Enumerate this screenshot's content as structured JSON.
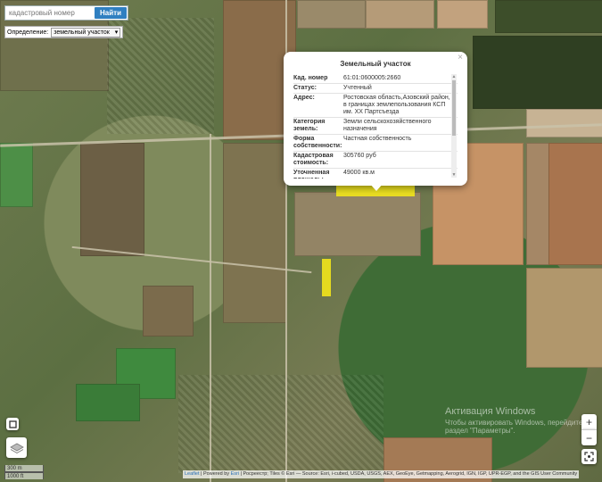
{
  "search": {
    "placeholder": "кадастровый номер",
    "button_label": "Найти"
  },
  "definition": {
    "label": "Определение:",
    "selected": "земельный участок",
    "dropdown_icon": "chevron-down-icon"
  },
  "popup": {
    "title": "Земельный участок",
    "close_symbol": "×",
    "rows": [
      {
        "key": "Кад. номер",
        "value": "61:01:0600005:2660"
      },
      {
        "key": "Статус:",
        "value": "Учтенный"
      },
      {
        "key": "Адрес:",
        "value": "Ростовская область,Азовский район, в границах землепользования КСП им. XX Партсъезда"
      },
      {
        "key": "Категория земель:",
        "value": "Земли сельскохозяйственного назначения"
      },
      {
        "key": "Форма собственности:",
        "value": "Частная собственность"
      },
      {
        "key": "Кадастровая стоимость:",
        "value": "305760 руб"
      },
      {
        "key": "Уточненная площадь:",
        "value": "49000 кв.м"
      }
    ]
  },
  "controls": {
    "zoom_in": "+",
    "zoom_out": "−",
    "locate_icon": "locate-icon",
    "draw_icon": "square-draw-icon",
    "layers_icon": "layers-icon"
  },
  "scale": {
    "metric": "300 m",
    "imperial": "1000 ft"
  },
  "attribution": {
    "leaflet": "Leaflet",
    "powered": " | Powered by ",
    "esri": "Esri",
    "rest": " | Росреестр; Tiles © Esri — Source: Esri, i-cubed, USDA, USGS, AEX, GeoEye, Getmapping, Aerogrid, IGN, IGP, UPR-EGP, and the GIS User Community"
  },
  "watermark": {
    "line1": "Активация Windows",
    "line2": "Чтобы активировать Windows, перейдите в раздел \"Параметры\"."
  },
  "colors": {
    "parcel_highlight": "#f2e61b",
    "button_blue": "#2f7fc1"
  }
}
